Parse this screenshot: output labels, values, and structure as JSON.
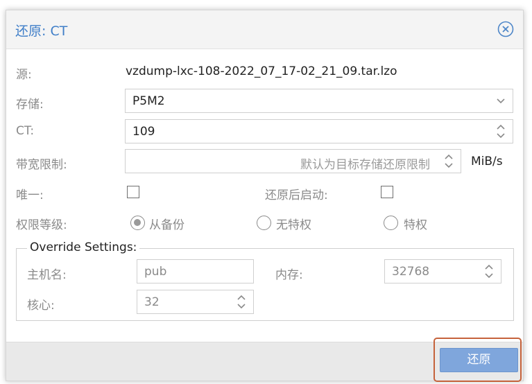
{
  "dialog": {
    "title": "还原: CT",
    "close_icon": "close-circle-icon"
  },
  "form": {
    "source_label": "源:",
    "source_value": "vzdump-lxc-108-2022_07_17-02_21_09.tar.lzo",
    "storage_label": "存储:",
    "storage_value": "P5M2",
    "ct_label": "CT:",
    "ct_value": "109",
    "bwlimit_label": "带宽限制:",
    "bwlimit_placeholder": "默认为目标存储还原限制",
    "bwlimit_unit": "MiB/s",
    "unique_label": "唯一:",
    "unique_checked": false,
    "start_after_label": "还原后启动:",
    "start_after_checked": false,
    "privilege_label": "权限等级:",
    "privilege_options": [
      {
        "label": "从备份",
        "checked": true
      },
      {
        "label": "无特权",
        "checked": false
      },
      {
        "label": "特权",
        "checked": false
      }
    ]
  },
  "override": {
    "legend": "Override Settings:",
    "hostname_label": "主机名:",
    "hostname_value": "pub",
    "memory_label": "内存:",
    "memory_value": "32768",
    "cores_label": "核心:",
    "cores_value": "32"
  },
  "footer": {
    "restore_label": "还原"
  },
  "colors": {
    "title": "#3f7ec8",
    "button": "#7fa6dc",
    "highlight": "#c5623b"
  }
}
